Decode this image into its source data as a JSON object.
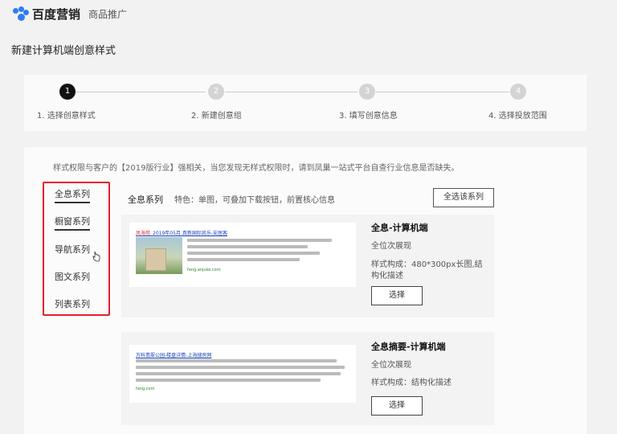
{
  "header": {
    "brand": "百度营销",
    "product": "商品推广"
  },
  "page_title": "新建计算机端创意样式",
  "steps": [
    {
      "number": "1",
      "label": "1. 选择创意样式",
      "active": true
    },
    {
      "number": "2",
      "label": "2. 新建创意组",
      "active": false
    },
    {
      "number": "3",
      "label": "3. 填写创意信息",
      "active": false
    },
    {
      "number": "4",
      "label": "4. 选择投放范围",
      "active": false
    }
  ],
  "notice": "样式权限与客户的【2019版行业】强相关，当您发现无样式权限时，请到凤巢一站式平台自查行业信息是否缺失。",
  "nav": {
    "items": [
      {
        "label": "全息系列"
      },
      {
        "label": "橱窗系列"
      },
      {
        "label": "导航系列"
      },
      {
        "label": "图文系列"
      },
      {
        "label": "列表系列"
      }
    ],
    "highlight_color": "#e5202b"
  },
  "series": {
    "title": "全息系列",
    "desc": "特色：单图，可叠加下载按钮，前置核心信息",
    "select_all": "全选该系列"
  },
  "cards": [
    {
      "name": "全息-计算机端",
      "sub1": "全位次展现",
      "sub2": "样式构成：480*300px长图,结",
      "sub3": "构化描述",
      "button": "选择",
      "preview_title_red": "凤海苑",
      "preview_title": "_2019年05月 真新国际凯乐-安居客",
      "preview_url": "fang.anjuke.com"
    },
    {
      "name": "全息摘要-计算机端",
      "sub1": "全位次展现",
      "sub2": "样式构成：结构化描述",
      "button": "选择",
      "preview_title": "万科翡翠公园-楼盘详情-上海搜房网",
      "preview_url": "fang.com"
    }
  ]
}
